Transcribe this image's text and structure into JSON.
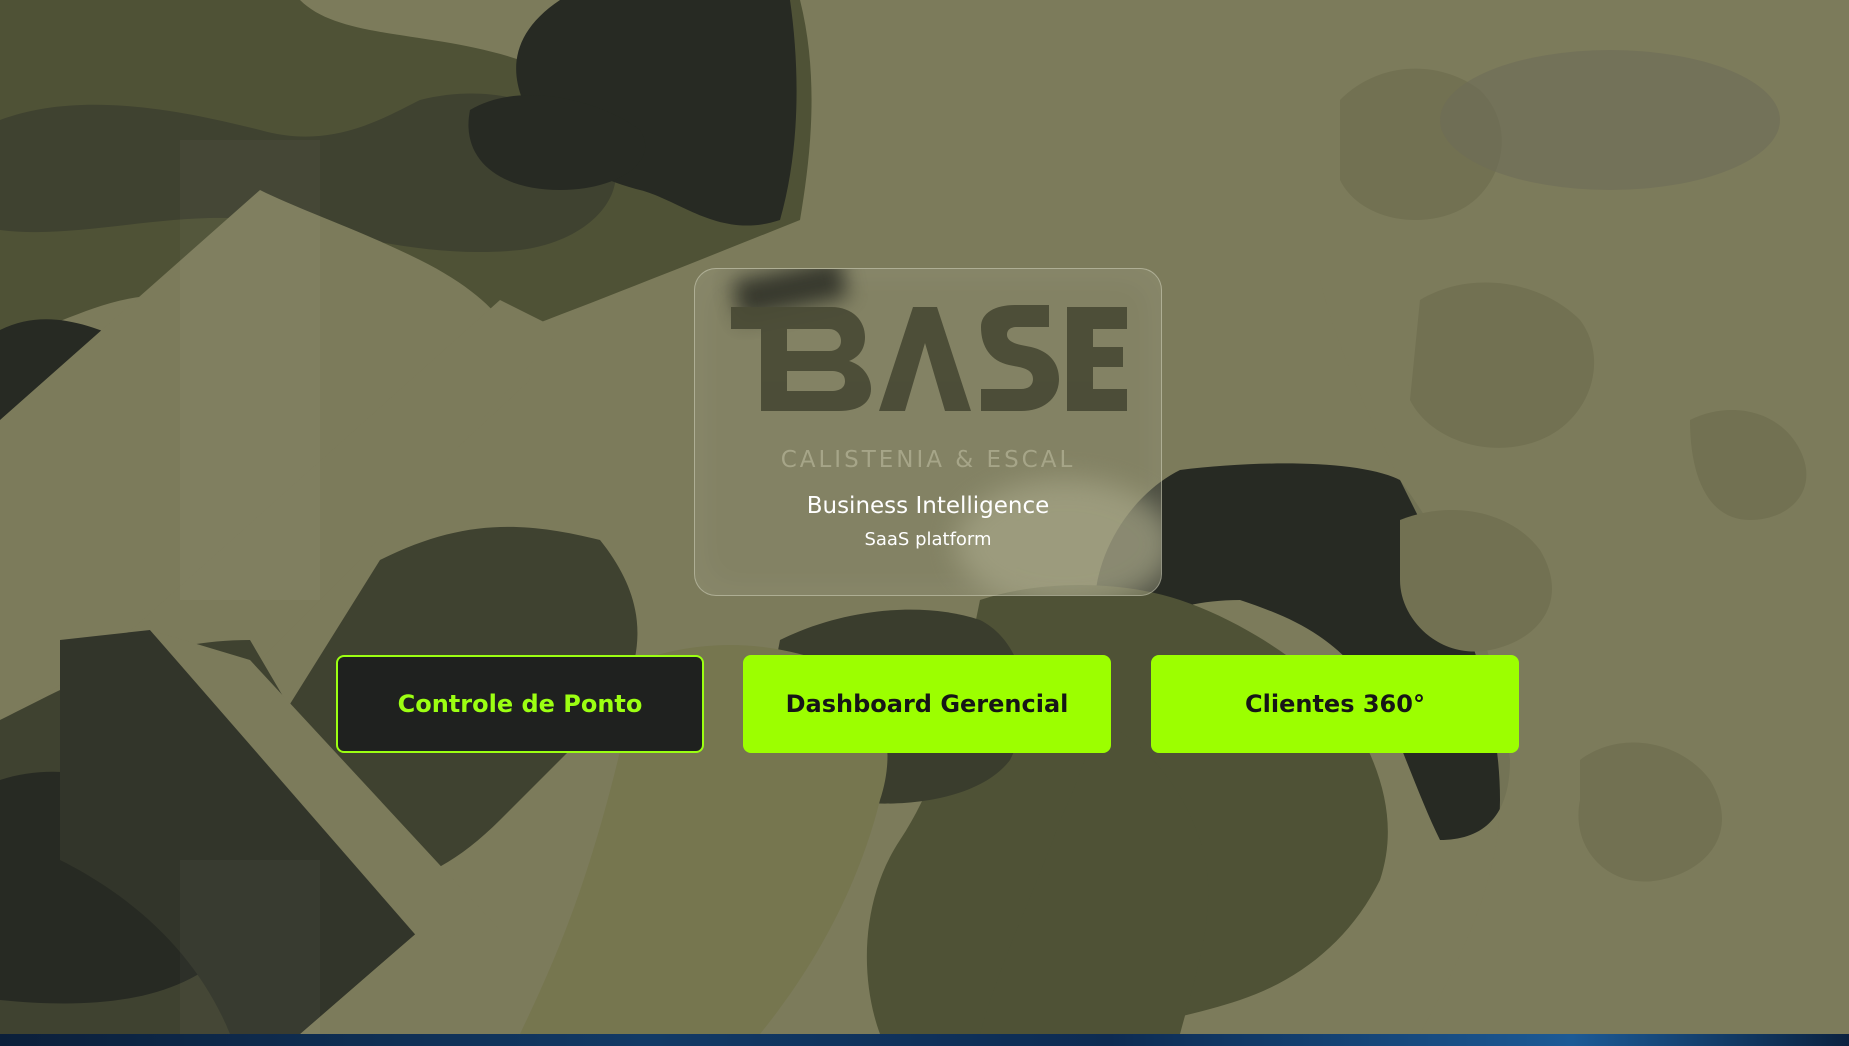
{
  "brand": {
    "logo_text": "BASE",
    "logo_subtitle": "CALISTENIA & ESCAL",
    "title": "Business Intelligence",
    "subtitle": "SaaS platform"
  },
  "nav_buttons": [
    {
      "label": "Controle de Ponto",
      "active": true
    },
    {
      "label": "Dashboard Gerencial",
      "active": false
    },
    {
      "label": "Clientes 360°",
      "active": false
    }
  ],
  "colors": {
    "accent": "#9cff00",
    "background_camo_light": "#7c7b5b",
    "background_camo_mid": "#4f5236",
    "background_camo_dark": "#272a23",
    "button_dark": "#1f211f"
  },
  "background": {
    "pattern": "camouflage"
  }
}
